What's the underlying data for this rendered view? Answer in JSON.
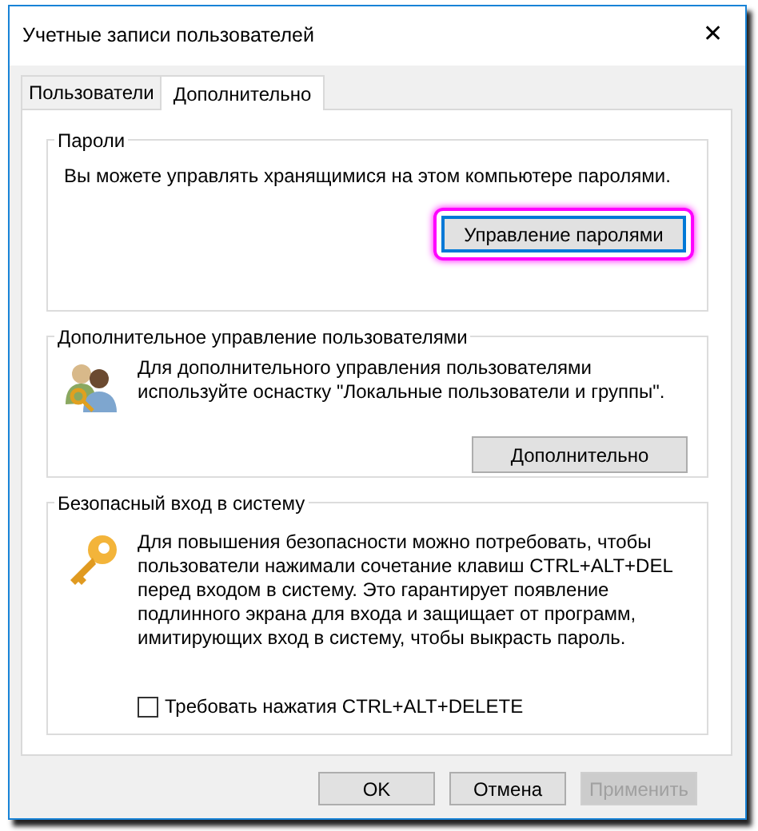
{
  "window": {
    "title": "Учетные записи пользователей",
    "close": "✕"
  },
  "tabs": [
    {
      "label": "Пользователи",
      "selected": false
    },
    {
      "label": "Дополнительно",
      "selected": true
    }
  ],
  "groups": [
    {
      "title": "Пароли",
      "kind": "plain",
      "text": "Вы можете управлять хранящимися на этом компьютере паролями.",
      "button": {
        "label": "Управление паролями",
        "focused": true,
        "highlighted": true
      }
    },
    {
      "title": "Дополнительное управление пользователями",
      "kind": "users",
      "text": "Для дополнительного управления пользователями используйте оснастку \"Локальные пользователи и группы\".",
      "button": {
        "label": "Дополнительно",
        "focused": false,
        "highlighted": false
      }
    },
    {
      "title": "Безопасный вход в систему",
      "kind": "key",
      "text": "Для повышения безопасности можно потребовать, чтобы пользователи нажимали сочетание клавиш CTRL+ALT+DEL перед входом в систему. Это гарантирует появление подлинного экрана для входа и защищает от программ, имитирующих вход в систему, чтобы выкрасть пароль.",
      "checkbox": {
        "label": "Требовать нажатия CTRL+ALT+DELETE",
        "checked": false
      }
    }
  ],
  "buttons": [
    {
      "label": "OK",
      "disabled": false
    },
    {
      "label": "Отмена",
      "disabled": false
    },
    {
      "label": "Применить",
      "disabled": true
    }
  ]
}
